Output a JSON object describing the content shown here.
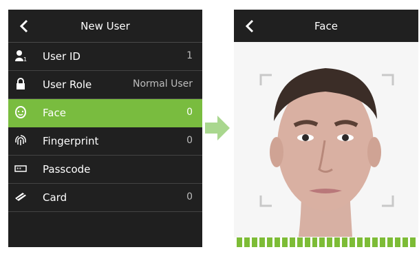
{
  "left_screen": {
    "title": "New User",
    "rows": [
      {
        "name": "user-id",
        "icon": "user-id-icon",
        "label": "User ID",
        "value": "1"
      },
      {
        "name": "user-role",
        "icon": "lock-icon",
        "label": "User Role",
        "value": "Normal User"
      },
      {
        "name": "face",
        "icon": "face-icon",
        "label": "Face",
        "value": "0",
        "active": true
      },
      {
        "name": "fingerprint",
        "icon": "fingerprint-icon",
        "label": "Fingerprint",
        "value": "0"
      },
      {
        "name": "passcode",
        "icon": "passcode-icon",
        "label": "Passcode",
        "value": ""
      },
      {
        "name": "card",
        "icon": "card-icon",
        "label": "Card",
        "value": "0"
      }
    ]
  },
  "right_screen": {
    "title": "Face",
    "progress_fraction": 1.0
  },
  "colors": {
    "active": "#79bc3f",
    "screen_bg": "#1f1f1f"
  },
  "icons": {
    "back": "chevron-left-icon",
    "transition": "arrow-right-icon"
  }
}
